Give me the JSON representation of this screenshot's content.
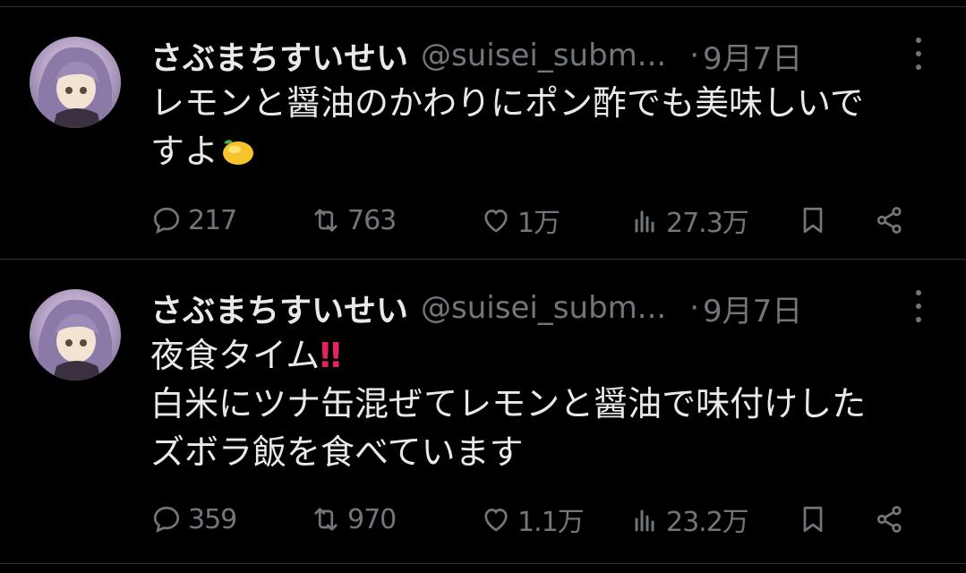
{
  "tweets": [
    {
      "display_name": "さぶまちすいせい",
      "handle": "@suisei_subm...",
      "separator": "·",
      "date": "9月7日",
      "lines": [
        "レモンと醤油のかわりにポン酢でも美味しいで",
        "すよ"
      ],
      "emoji": "lemon",
      "replies": "217",
      "retweets": "763",
      "likes": "1万",
      "views": "27.3万"
    },
    {
      "display_name": "さぶまちすいせい",
      "handle": "@suisei_subm...",
      "separator": "·",
      "date": "9月7日",
      "lines": [
        "夜食タイム",
        "白米にツナ缶混ぜてレモンと醤油で味付けした",
        "ズボラ飯を食べています"
      ],
      "emoji": "double-exclamation",
      "bangs": "‼",
      "replies": "359",
      "retweets": "970",
      "likes": "1.1万",
      "views": "23.2万"
    }
  ],
  "colors": {
    "background": "#000000",
    "text": "#e7e9ea",
    "secondary": "#71767b",
    "divider": "#2f3336",
    "accent_red": "#e0245e"
  }
}
